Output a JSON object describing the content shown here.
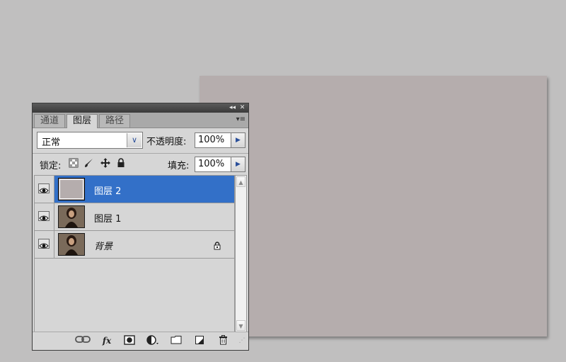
{
  "panel": {
    "tabs": [
      {
        "label": "通道",
        "active": false
      },
      {
        "label": "图层",
        "active": true
      },
      {
        "label": "路径",
        "active": false
      }
    ],
    "collapse_glyph": "◂◂",
    "close_glyph": "✕",
    "menu_glyph": "▾≡",
    "blend_mode": "正常",
    "opacity_label": "不透明度:",
    "opacity_value": "100%",
    "lock_label": "锁定:",
    "fill_label": "填充:",
    "fill_value": "100%"
  },
  "layers": [
    {
      "name": "图层 2",
      "selected": true,
      "visible": true,
      "thumbnail": "gray-fill",
      "locked": false
    },
    {
      "name": "图层 1",
      "selected": false,
      "visible": true,
      "thumbnail": "portrait-photo",
      "locked": false
    },
    {
      "name": "背景",
      "selected": false,
      "visible": true,
      "thumbnail": "portrait-photo",
      "locked": true
    }
  ],
  "bottom_icons": [
    "link-icon",
    "fx-icon",
    "mask-icon",
    "adjustment-icon",
    "folder-icon",
    "new-layer-icon",
    "trash-icon"
  ],
  "bottom_fx_text": "fx",
  "colors": {
    "selection": "#3370c8",
    "canvas": "#b5adad",
    "workspace": "#c0bfbf"
  }
}
